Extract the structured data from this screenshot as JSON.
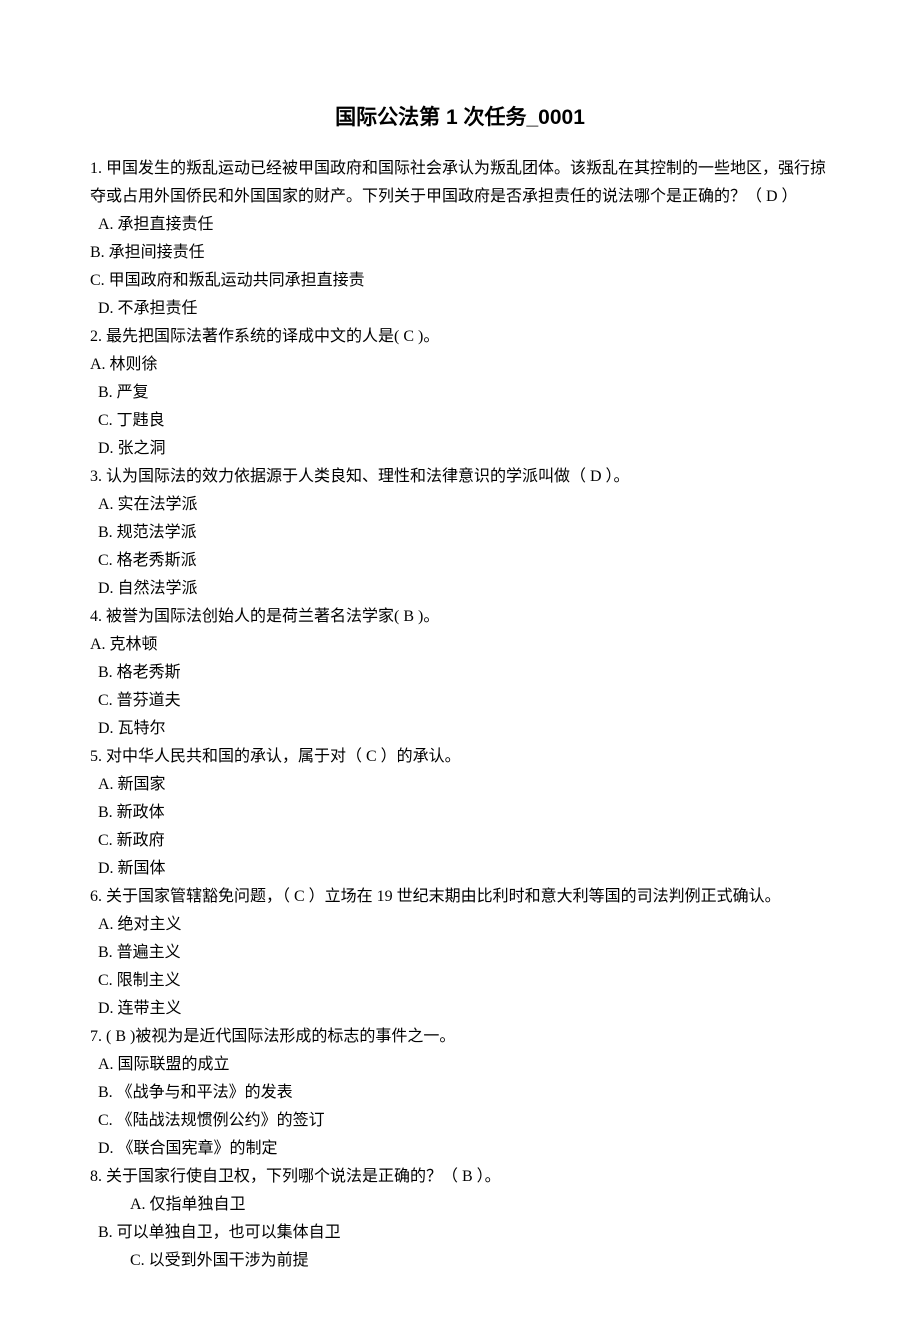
{
  "title": "国际公法第 1 次任务_0001",
  "questions": [
    {
      "stem": "1.   甲国发生的叛乱运动已经被甲国政府和国际社会承认为叛乱团体。该叛乱在其控制的一些地区，强行掠夺或占用外国侨民和外国国家的财产。下列关于甲国政府是否承担责任的说法哪个是正确的？（   D   ）",
      "options": [
        {
          "t": " A.  承担直接责任",
          "cls": ""
        },
        {
          "t": "B.  承担间接责任",
          "cls": "indent-sm"
        },
        {
          "t": "C.  甲国政府和叛乱运动共同承担直接责",
          "cls": "indent-sm"
        },
        {
          "t": " D.  不承担责任",
          "cls": ""
        }
      ]
    },
    {
      "stem": "2.   最先把国际法著作系统的译成中文的人是(      C      )。",
      "options": [
        {
          "t": "A.  林则徐",
          "cls": "indent-sm"
        },
        {
          "t": " B.  严复",
          "cls": ""
        },
        {
          "t": " C.  丁韪良",
          "cls": ""
        },
        {
          "t": " D.  张之洞",
          "cls": ""
        }
      ]
    },
    {
      "stem": "3.   认为国际法的效力依据源于人类良知、理性和法律意识的学派叫做（    D    ）。",
      "options": [
        {
          "t": " A.  实在法学派",
          "cls": ""
        },
        {
          "t": " B.  规范法学派",
          "cls": ""
        },
        {
          "t": " C.  格老秀斯派",
          "cls": ""
        },
        {
          "t": " D.  自然法学派",
          "cls": ""
        }
      ]
    },
    {
      "stem": "4.   被誉为国际法创始人的是荷兰著名法学家(    B      )。",
      "options": [
        {
          "t": "A.  克林顿",
          "cls": "indent-sm"
        },
        {
          "t": " B.  格老秀斯",
          "cls": ""
        },
        {
          "t": " C.  普芬道夫",
          "cls": ""
        },
        {
          "t": " D.  瓦特尔",
          "cls": ""
        }
      ]
    },
    {
      "stem": "5.   对中华人民共和国的承认，属于对（    C      ）的承认。",
      "options": [
        {
          "t": " A.  新国家",
          "cls": ""
        },
        {
          "t": " B.  新政体",
          "cls": ""
        },
        {
          "t": " C.  新政府",
          "cls": ""
        },
        {
          "t": " D.  新国体",
          "cls": ""
        }
      ]
    },
    {
      "stem": "6.   关于国家管辖豁免问题，（  C       ）立场在 19 世纪末期由比利时和意大利等国的司法判例正式确认。",
      "options": [
        {
          "t": " A.  绝对主义",
          "cls": ""
        },
        {
          "t": " B.  普遍主义",
          "cls": ""
        },
        {
          "t": " C.  限制主义",
          "cls": ""
        },
        {
          "t": " D.  连带主义",
          "cls": ""
        }
      ]
    },
    {
      "stem": "7.   (       B      )被视为是近代国际法形成的标志的事件之一。",
      "options": [
        {
          "t": " A.  国际联盟的成立",
          "cls": ""
        },
        {
          "t": " B.  《战争与和平法》的发表",
          "cls": ""
        },
        {
          "t": " C.  《陆战法规惯例公约》的签订",
          "cls": ""
        },
        {
          "t": " D.  《联合国宪章》的制定",
          "cls": ""
        }
      ]
    },
    {
      "stem": "8.   关于国家行使自卫权，下列哪个说法是正确的？（     B     ）。",
      "options": [
        {
          "t": "A.  仅指单独自卫",
          "cls": "indent-lg"
        },
        {
          "t": " B.  可以单独自卫，也可以集体自卫",
          "cls": ""
        },
        {
          "t": "C.  以受到外国干涉为前提",
          "cls": "indent-lg"
        }
      ]
    }
  ]
}
